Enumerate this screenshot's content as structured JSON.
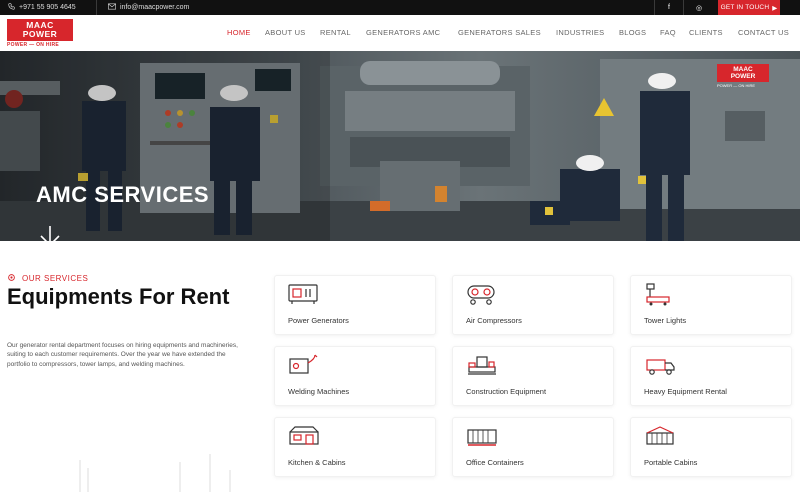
{
  "topbar": {
    "phone": "+971 55 905 4645",
    "email": "info@maacpower.com",
    "cta": "GET IN TOUCH",
    "social": [
      {
        "icon": "facebook-icon",
        "glyph": "f"
      },
      {
        "icon": "instagram-icon",
        "glyph": "◎"
      },
      {
        "icon": "youtube-icon",
        "glyph": "▶"
      }
    ]
  },
  "logo": {
    "line1": "MAAC",
    "line2": "POWER",
    "tagline": "POWER — ON HIRE"
  },
  "nav": [
    {
      "label": "HOME",
      "active": true
    },
    {
      "label": "ABOUT US",
      "active": false
    },
    {
      "label": "RENTAL",
      "active": false
    },
    {
      "label": "GENERATORS AMC",
      "active": false
    },
    {
      "label": "GENERATORS SALES",
      "active": false
    },
    {
      "label": "INDUSTRIES",
      "active": false
    },
    {
      "label": "BLOGS",
      "active": false
    },
    {
      "label": "FAQ",
      "active": false
    },
    {
      "label": "CLIENTS",
      "active": false
    },
    {
      "label": "CONTACT US",
      "active": false
    }
  ],
  "hero": {
    "title": "AMC SERVICES",
    "arrow_icon": "arrow-down-icon",
    "watermark_line1": "MAAC",
    "watermark_line2": "POWER",
    "watermark_tag": "POWER — ON HIRE"
  },
  "services": {
    "label": "OUR SERVICES",
    "title": "Equipments For Rent",
    "description": "Our generator rental department focuses on hiring equipments and machineries, suiting to each customer requirements. Over the year we have extended the portfolio to compressors, tower lamps, and welding machines.",
    "items": [
      {
        "label": "Power Generators",
        "icon": "power-generator-icon"
      },
      {
        "label": "Air Compressors",
        "icon": "air-compressor-icon"
      },
      {
        "label": "Tower Lights",
        "icon": "tower-light-icon"
      },
      {
        "label": "Welding Machines",
        "icon": "welding-machine-icon"
      },
      {
        "label": "Construction Equipment",
        "icon": "construction-equipment-icon"
      },
      {
        "label": "Heavy Equipment Rental",
        "icon": "heavy-equipment-icon"
      },
      {
        "label": "Kitchen & Cabins",
        "icon": "kitchen-cabin-icon"
      },
      {
        "label": "Office Containers",
        "icon": "office-container-icon"
      },
      {
        "label": "Portable Cabins",
        "icon": "portable-cabin-icon"
      }
    ]
  },
  "colors": {
    "brand": "#d7262c",
    "dark": "#111111",
    "text": "#333333"
  }
}
